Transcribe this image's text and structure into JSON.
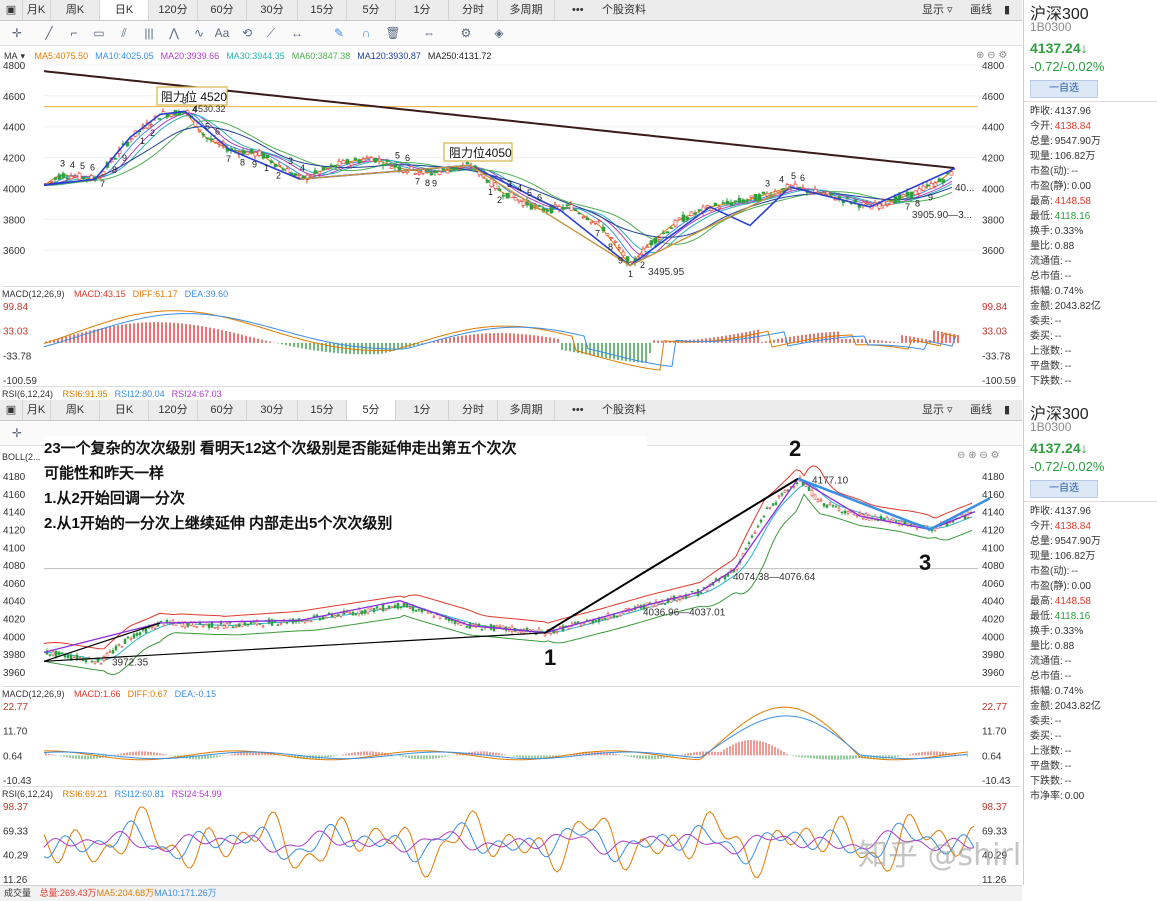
{
  "tabs": [
    "月K",
    "周K",
    "日K",
    "120分",
    "60分",
    "30分",
    "15分",
    "5分",
    "1分",
    "分时",
    "多周期"
  ],
  "tab_more": "•••",
  "stock_info_tab": "个股资料",
  "display_label": "显示",
  "draw_label": "画线",
  "top": {
    "active_tab": 2,
    "indicator_name": "MA",
    "ma_values": [
      {
        "label": "MA5:4075.50",
        "color": "#e07b00"
      },
      {
        "label": "MA10:4025.05",
        "color": "#3a8ee6"
      },
      {
        "label": "MA20:3939.66",
        "color": "#b03cc8"
      },
      {
        "label": "MA30:3944.35",
        "color": "#27b3b3"
      },
      {
        "label": "MA60:3847.38",
        "color": "#4caf50"
      },
      {
        "label": "MA120:3930.87",
        "color": "#1f3f9a"
      },
      {
        "label": "MA250:4131.72",
        "color": "#222222"
      }
    ],
    "y_ticks": [
      "4800",
      "4600",
      "4400",
      "4200",
      "4000",
      "3800",
      "3600"
    ],
    "resistance_1": "阻力位 4520",
    "resistance_2": "阻力位4050",
    "high_label": "4530.32",
    "low_label": "3495.95",
    "right_labels": [
      "40...",
      "3905.90—3..."
    ],
    "count_labels": [
      "3",
      "4",
      "5",
      "6",
      "7",
      "8",
      "9",
      "1",
      "2",
      "3",
      "4",
      "5",
      "6",
      "7",
      "8",
      "9",
      "1",
      "2",
      "3",
      "4",
      "5",
      "6",
      "7",
      "8",
      "9",
      "1",
      "2",
      "3",
      "4",
      "5",
      "6",
      "7",
      "8",
      "9",
      "1",
      "2",
      "3",
      "4",
      "5",
      "6",
      "7",
      "8",
      "9"
    ],
    "macd_header": "MACD(12,26,9)",
    "macd_values": [
      {
        "label": "MACD:43.15",
        "color": "#e0392b"
      },
      {
        "label": "DIFF:61.17",
        "color": "#e07b00"
      },
      {
        "label": "DEA:39.60",
        "color": "#3a8ee6"
      }
    ],
    "macd_ticks": [
      "99.84",
      "33.03",
      "-33.78",
      "-100.59"
    ],
    "rsi_header": "RSI(6,12,24)",
    "rsi_values": [
      {
        "label": "RSI6:91.95",
        "color": "#e07b00"
      },
      {
        "label": "RSI12:80.04",
        "color": "#3a8ee6"
      },
      {
        "label": "RSI24:67.03",
        "color": "#b03cc8"
      }
    ]
  },
  "bottom": {
    "active_tab": 7,
    "indicator_name": "BOLL(2...",
    "y_ticks": [
      "4180",
      "4160",
      "4140",
      "4120",
      "4100",
      "4080",
      "4060",
      "4040",
      "4020",
      "4000",
      "3980",
      "3960"
    ],
    "annotation_lines": [
      "23一个复杂的次次级别 看明天12这个次级别是否能延伸走出第五个次次",
      "可能性和昨天一样",
      "1.从2开始回调一分次",
      "2.从1开始的一分次上继续延伸 内部走出5个次次级别"
    ],
    "point_labels": [
      "1",
      "2",
      "3"
    ],
    "price_labels": [
      "4177.10",
      "4074.38—4076.64",
      "4036.96—4037.01",
      "3972.35"
    ],
    "macd_header": "MACD(12,26,9)",
    "macd_values": [
      {
        "label": "MACD:1.66",
        "color": "#e0392b"
      },
      {
        "label": "DIFF:0.67",
        "color": "#e07b00"
      },
      {
        "label": "DEA:-0.15",
        "color": "#3a8ee6"
      }
    ],
    "macd_ticks": [
      "22.77",
      "11.70",
      "0.64",
      "-10.43"
    ],
    "rsi_header": "RSI(6,12,24)",
    "rsi_values": [
      {
        "label": "RSI6:69.21",
        "color": "#e07b00"
      },
      {
        "label": "RSI12:60.81",
        "color": "#3a8ee6"
      },
      {
        "label": "RSI24:54.99",
        "color": "#b03cc8"
      }
    ],
    "rsi_ticks": [
      "98.37",
      "69.33",
      "40.29",
      "11.26"
    ],
    "volume_header": "成交量",
    "volume_values": [
      {
        "label": "总量:269.43万",
        "color": "#e0392b"
      },
      {
        "label": "MA5:204.68万",
        "color": "#e07b00"
      },
      {
        "label": "MA10:171.26万",
        "color": "#3a8ee6"
      }
    ]
  },
  "watermark": "知乎 @shirley cai",
  "quote": {
    "name": "沪深300",
    "code": "1B0300",
    "price": "4137.24↓",
    "change": "-0.72/-0.02%",
    "watch_button": "一自选",
    "rows": [
      {
        "k": "昨收:",
        "v": "4137.96",
        "c": ""
      },
      {
        "k": "今开:",
        "v": "4138.84",
        "c": "red"
      },
      {
        "k": "总量:",
        "v": "9547.90万",
        "c": ""
      },
      {
        "k": "现量:",
        "v": "106.82万",
        "c": ""
      },
      {
        "k": "市盈(动):",
        "v": "--",
        "c": ""
      },
      {
        "k": "市盈(静):",
        "v": "0.00",
        "c": ""
      },
      {
        "k": "最高:",
        "v": "4148.58",
        "c": "red"
      },
      {
        "k": "最低:",
        "v": "4118.16",
        "c": "green"
      },
      {
        "k": "换手:",
        "v": "0.33%",
        "c": ""
      },
      {
        "k": "量比:",
        "v": "0.88",
        "c": ""
      },
      {
        "k": "流通值:",
        "v": "--",
        "c": ""
      },
      {
        "k": "总市值:",
        "v": "--",
        "c": ""
      },
      {
        "k": "振幅:",
        "v": "0.74%",
        "c": ""
      },
      {
        "k": "金额:",
        "v": "2043.82亿",
        "c": ""
      },
      {
        "k": "委卖:",
        "v": "--",
        "c": ""
      },
      {
        "k": "委买:",
        "v": "--",
        "c": ""
      },
      {
        "k": "上涨数:",
        "v": "--",
        "c": ""
      },
      {
        "k": "平盘数:",
        "v": "--",
        "c": ""
      },
      {
        "k": "下跌数:",
        "v": "--",
        "c": ""
      },
      {
        "k": "市净率:",
        "v": "0.00",
        "c": ""
      }
    ]
  },
  "chart_data": [
    {
      "type": "line",
      "title": "沪深300 日K",
      "ylim": [
        3400,
        4800
      ],
      "series": [
        {
          "name": "MA250",
          "values": [
            4760,
            4700,
            4640,
            4580,
            4520,
            4460,
            4400,
            4340,
            4280,
            4220,
            4160,
            4131.72
          ]
        }
      ],
      "annotations": [
        "阻力位 4520",
        "阻力位4050",
        "4530.32",
        "3495.95"
      ]
    },
    {
      "type": "line",
      "title": "沪深300 5分",
      "ylim": [
        3960,
        4180
      ],
      "series": [
        {
          "name": "price",
          "values": [
            3980,
            3972.35,
            4000,
            4015,
            4010,
            4030,
            4020,
            4037,
            4010,
            4004,
            4036.96,
            4050,
            4074.38,
            4177.1,
            4140,
            4125,
            4120,
            4140,
            4150
          ]
        }
      ],
      "annotations": [
        "1",
        "2",
        "3",
        "4177.10",
        "4074.38—4076.64",
        "4036.96—4037.01",
        "3972.35"
      ]
    }
  ]
}
